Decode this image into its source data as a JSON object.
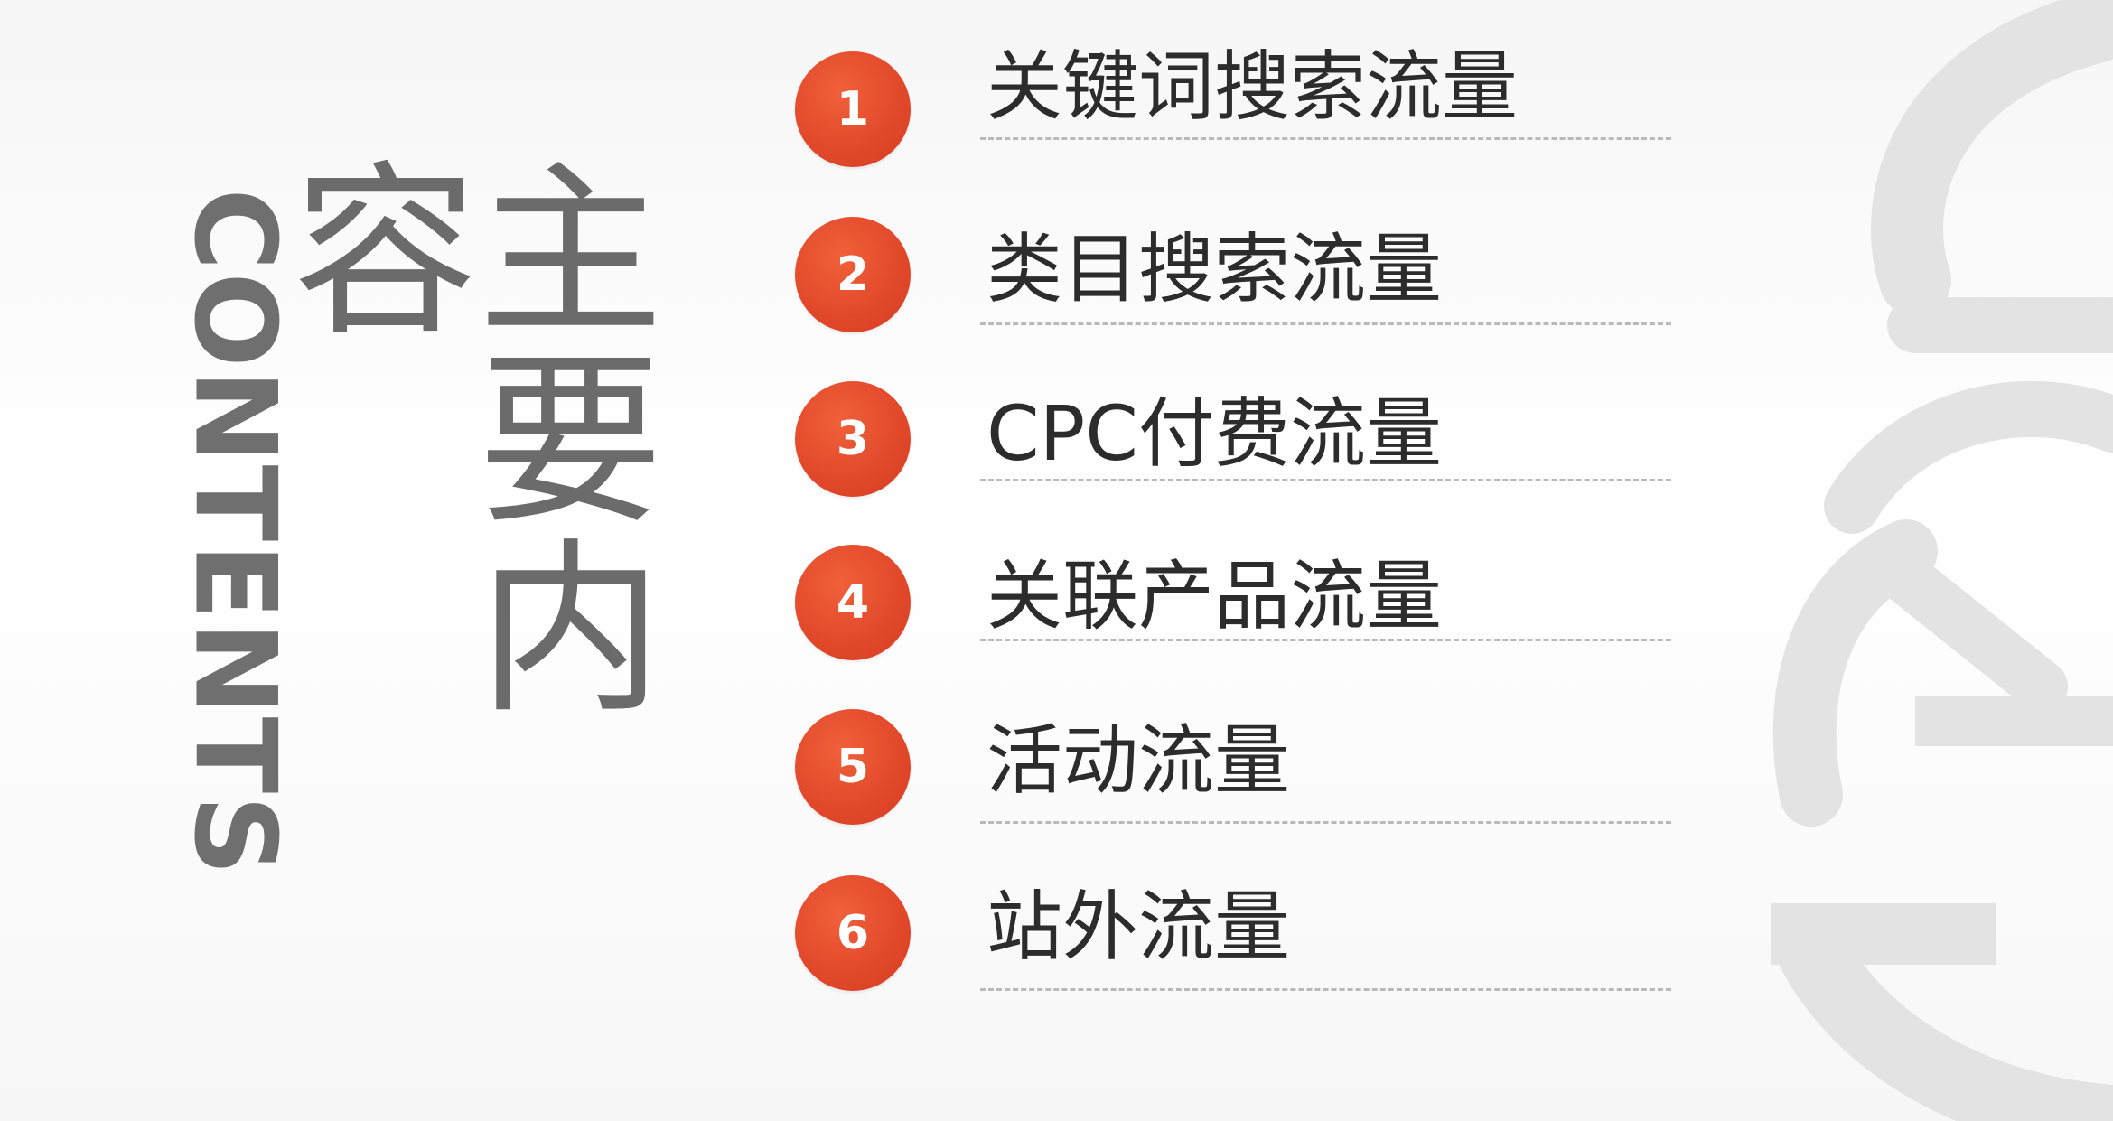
{
  "title": {
    "en": "CONTENTS",
    "zh": "主要内容"
  },
  "items": [
    {
      "number": "1",
      "label": "关键词搜索流量"
    },
    {
      "number": "2",
      "label": "类目搜索流量"
    },
    {
      "number": "3",
      "label": "CPC付费流量"
    },
    {
      "number": "4",
      "label": "关联产品流量"
    },
    {
      "number": "5",
      "label": "活动流量"
    },
    {
      "number": "6",
      "label": "站外流量"
    }
  ],
  "colors": {
    "accent": "#e44a2b",
    "title": "#6f6f6f",
    "text": "#2c2c2c",
    "watermark": "#e3e3e3"
  },
  "icons": {
    "watermark": "decorative-seal-icon"
  }
}
